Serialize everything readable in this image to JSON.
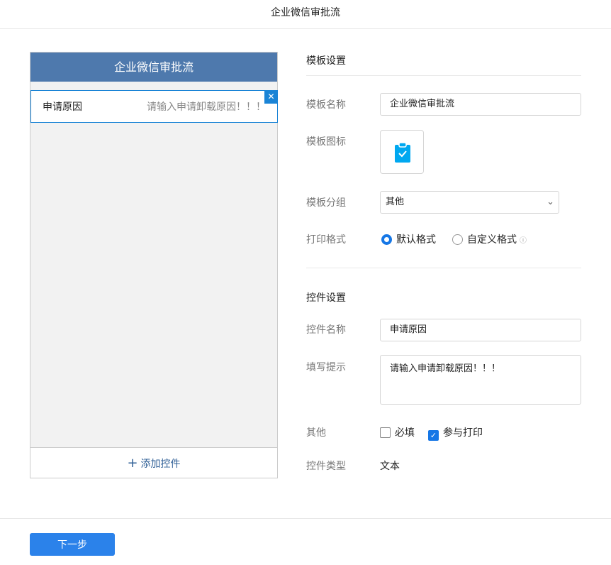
{
  "header": {
    "title": "企业微信审批流"
  },
  "preview": {
    "title": "企业微信审批流",
    "field_label": "申请原因",
    "field_hint": "请输入申请卸载原因！！！",
    "add_label": "添加控件"
  },
  "template": {
    "section": "模板设置",
    "name_label": "模板名称",
    "name_value": "企业微信审批流",
    "icon_label": "模板图标",
    "group_label": "模板分组",
    "group_value": "其他",
    "print_label": "打印格式",
    "print_default": "默认格式",
    "print_custom": "自定义格式"
  },
  "control": {
    "section": "控件设置",
    "name_label": "控件名称",
    "name_value": "申请原因",
    "hint_label": "填写提示",
    "hint_value": "请输入申请卸载原因！！！",
    "other_label": "其他",
    "required": "必填",
    "print": "参与打印",
    "type_label": "控件类型",
    "type_value": "文本"
  },
  "footer": {
    "next": "下一步"
  },
  "colors": {
    "accent": "#1677e6",
    "header": "#4e79ad",
    "icon": "#00a8f0"
  }
}
